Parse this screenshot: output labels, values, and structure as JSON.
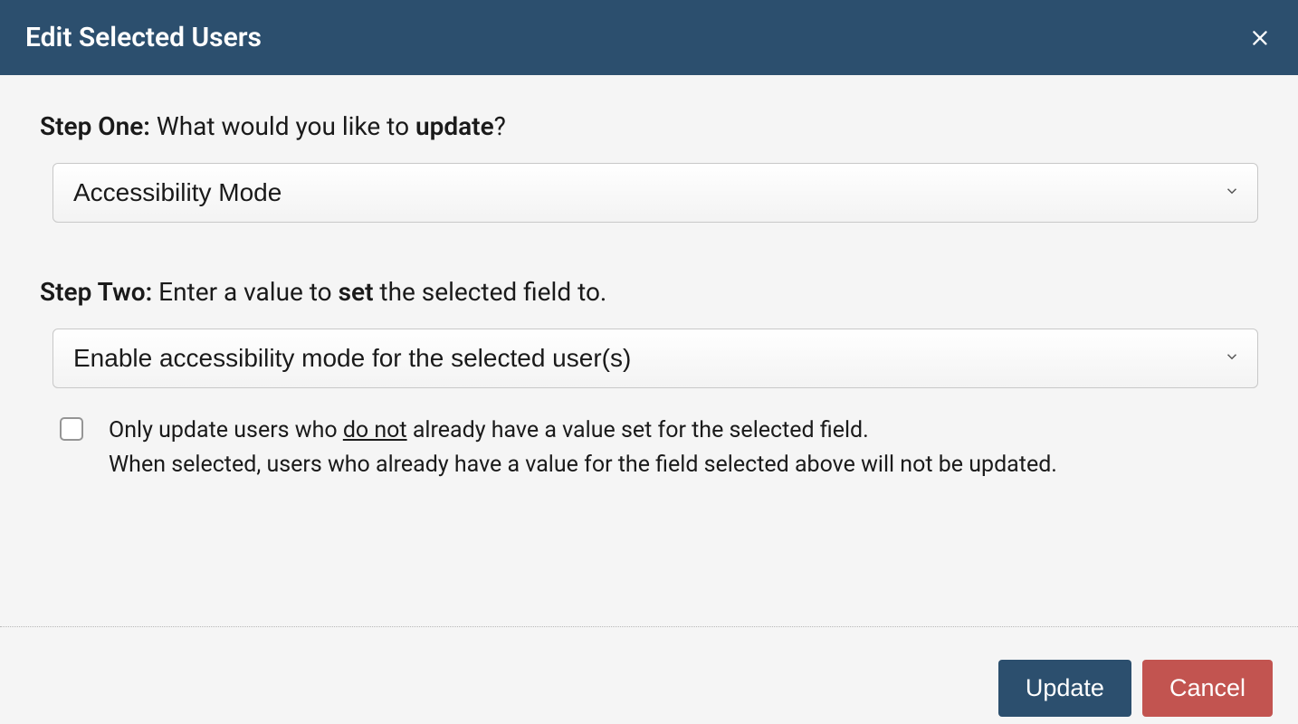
{
  "header": {
    "title": "Edit Selected Users"
  },
  "step_one": {
    "name": "Step One:",
    "prefix": " What would you like to ",
    "bold": "update",
    "suffix": "?"
  },
  "field_select": {
    "value": "Accessibility Mode"
  },
  "step_two": {
    "name": "Step Two:",
    "prefix": " Enter a value to ",
    "bold": "set",
    "suffix": " the selected field to."
  },
  "value_select": {
    "value": "Enable accessibility mode for the selected user(s)"
  },
  "checkbox": {
    "main_pre": "Only update users who ",
    "main_underlined": "do not",
    "main_post": " already have a value set for the selected field.",
    "helper": "When selected, users who already have a value for the field selected above will not be updated."
  },
  "footer": {
    "update": "Update",
    "cancel": "Cancel"
  }
}
